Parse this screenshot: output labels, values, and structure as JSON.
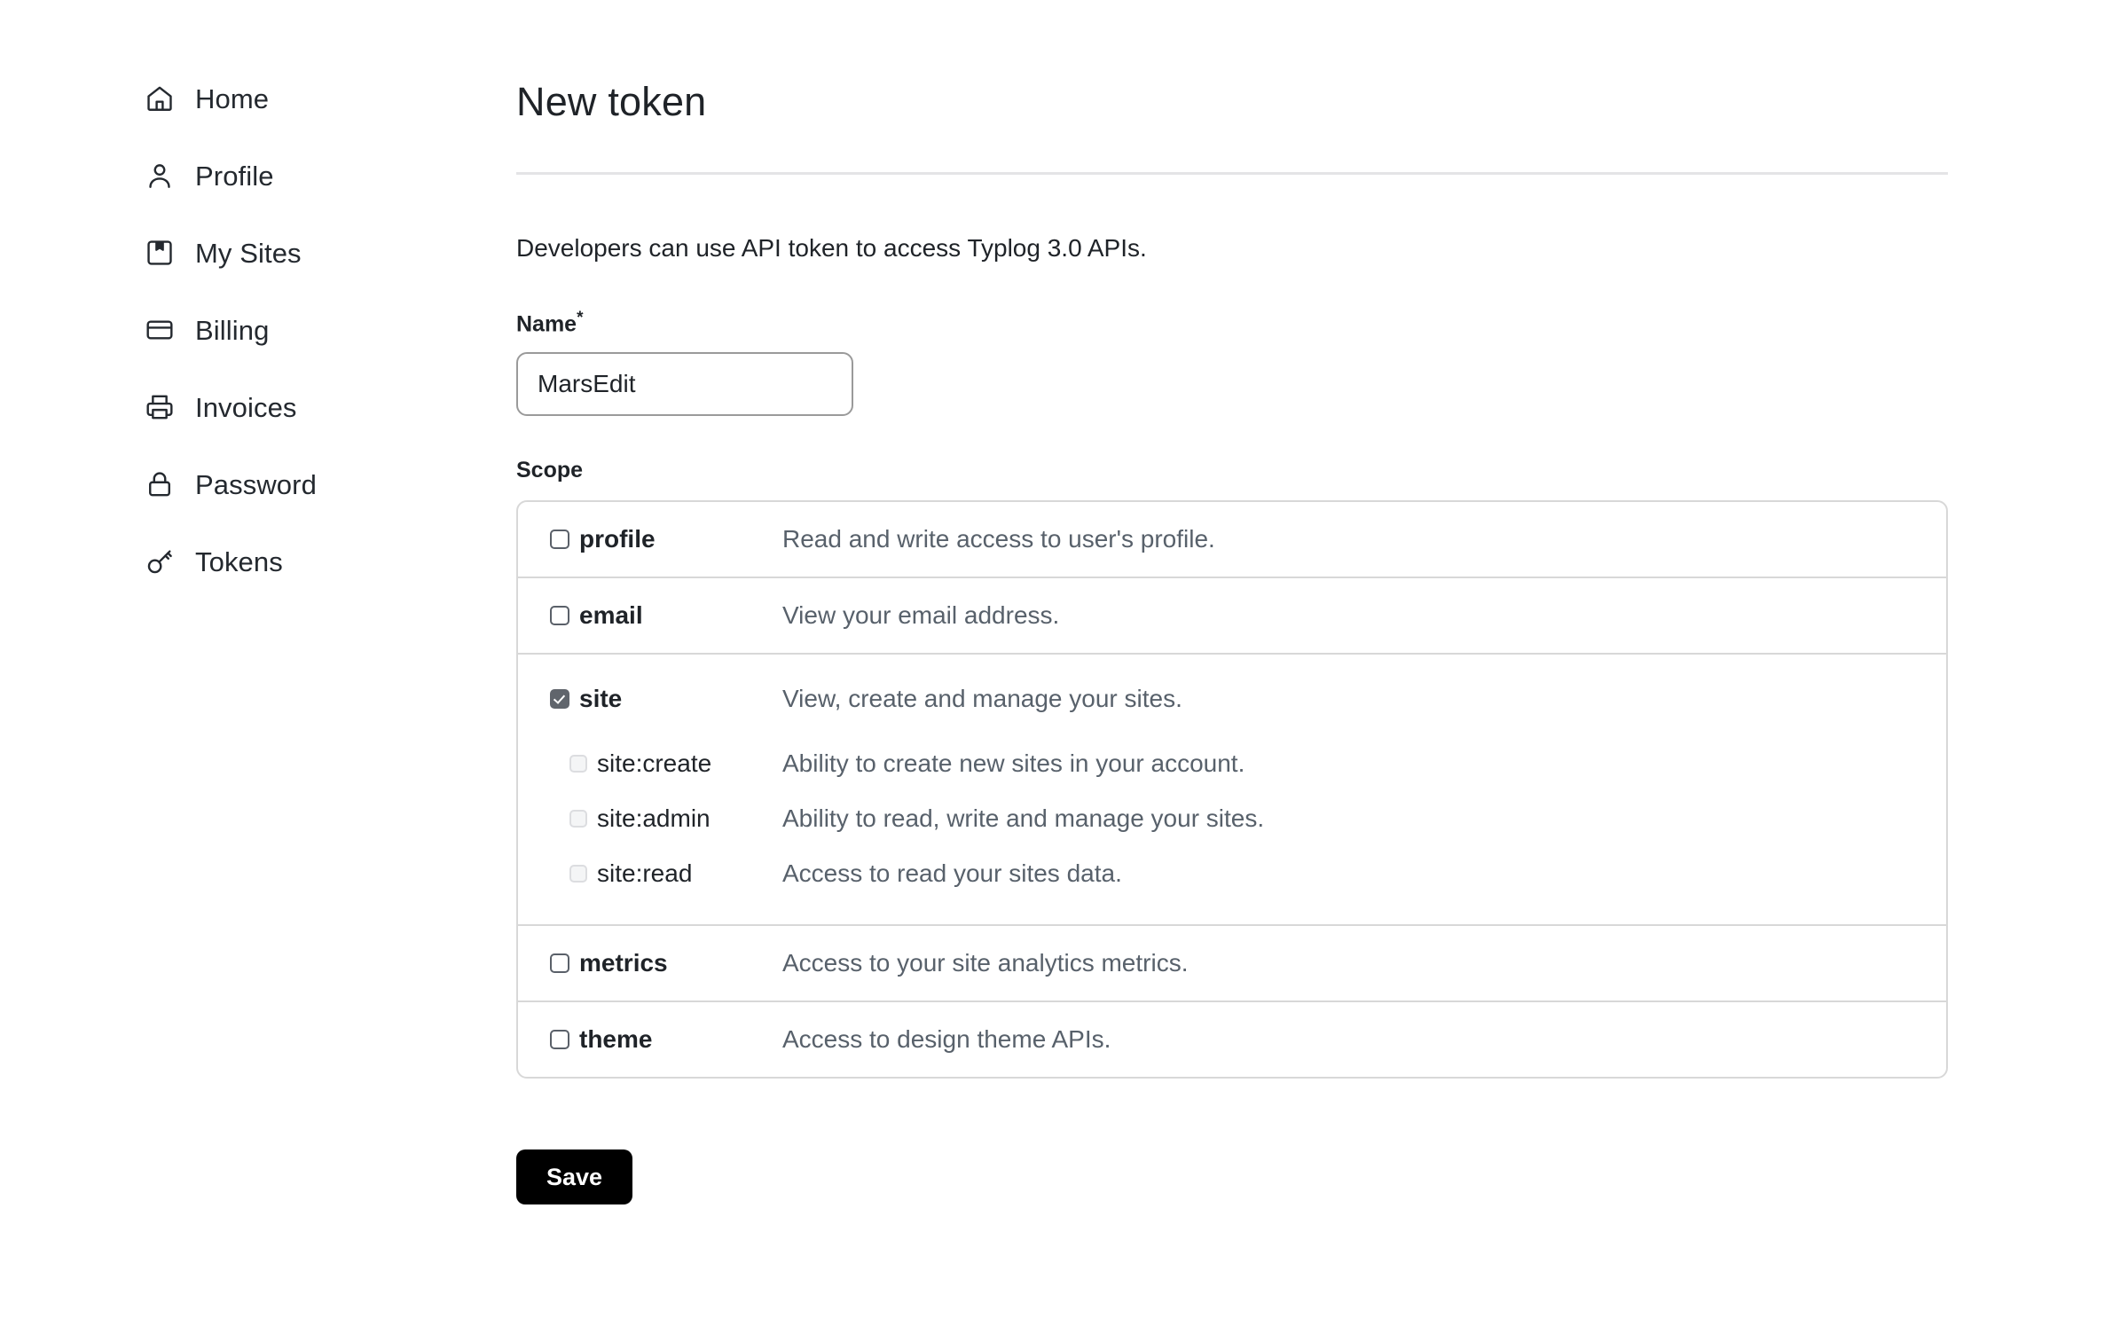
{
  "sidebar": {
    "items": [
      {
        "label": "Home",
        "icon": "home-icon"
      },
      {
        "label": "Profile",
        "icon": "user-icon"
      },
      {
        "label": "My Sites",
        "icon": "bookmark-box-icon"
      },
      {
        "label": "Billing",
        "icon": "credit-card-icon"
      },
      {
        "label": "Invoices",
        "icon": "printer-icon"
      },
      {
        "label": "Password",
        "icon": "lock-icon"
      },
      {
        "label": "Tokens",
        "icon": "key-icon"
      }
    ]
  },
  "main": {
    "title": "New token",
    "intro": "Developers can use API token to access Typlog 3.0 APIs.",
    "name_field": {
      "label": "Name",
      "required_mark": "*",
      "value": "MarsEdit",
      "placeholder": ""
    },
    "scope_label": "Scope",
    "scopes": [
      {
        "id": "profile",
        "label": "profile",
        "description": "Read and write access to user's profile.",
        "checked": false,
        "children": []
      },
      {
        "id": "email",
        "label": "email",
        "description": "View your email address.",
        "checked": false,
        "children": []
      },
      {
        "id": "site",
        "label": "site",
        "description": "View, create and manage your sites.",
        "checked": true,
        "children": [
          {
            "id": "site-create",
            "label": "site:create",
            "description": "Ability to create new sites in your account.",
            "checked": false
          },
          {
            "id": "site-admin",
            "label": "site:admin",
            "description": "Ability to read, write and manage your sites.",
            "checked": false
          },
          {
            "id": "site-read",
            "label": "site:read",
            "description": "Access to read your sites data.",
            "checked": false
          }
        ]
      },
      {
        "id": "metrics",
        "label": "metrics",
        "description": "Access to your site analytics metrics.",
        "checked": false,
        "children": []
      },
      {
        "id": "theme",
        "label": "theme",
        "description": "Access to design theme APIs.",
        "checked": false,
        "children": []
      }
    ],
    "save_label": "Save"
  },
  "colors": {
    "text": "#1f2328",
    "muted_text": "#58616b",
    "border": "#d8d8d8",
    "input_border": "#9a9a9a",
    "checked_checkbox": "#60656c",
    "button_bg": "#000000",
    "button_text": "#ffffff"
  }
}
